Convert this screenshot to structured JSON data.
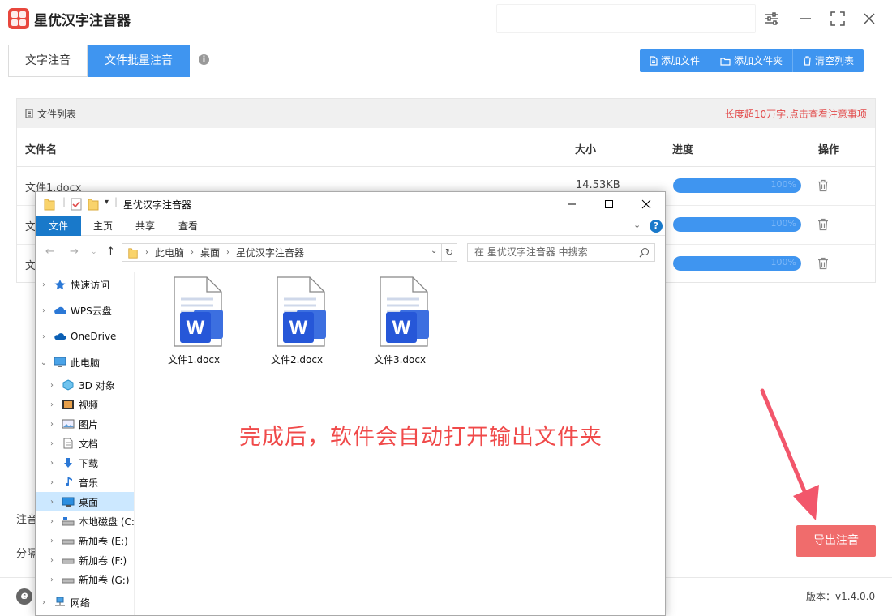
{
  "app": {
    "title": "星优汉字注音器",
    "tabs": [
      {
        "label": "文字注音",
        "active": false
      },
      {
        "label": "文件批量注音",
        "active": true
      }
    ],
    "toolbar": {
      "add_file": "添加文件",
      "add_folder": "添加文件夹",
      "clear_list": "清空列表"
    },
    "panel": {
      "title": "文件列表",
      "warning": "长度超10万字,点击查看注意事项",
      "columns": {
        "name": "文件名",
        "size": "大小",
        "progress": "进度",
        "action": "操作"
      },
      "rows": [
        {
          "name": "文件1.docx",
          "size": "14.53KB",
          "progress": "100%",
          "progress_value": 100
        },
        {
          "name": "文",
          "size": "",
          "progress": "100%",
          "progress_value": 100
        },
        {
          "name": "文",
          "size": "",
          "progress": "100%",
          "progress_value": 100
        }
      ]
    },
    "side_labels": [
      "注音",
      "分隔"
    ],
    "export_button": "导出注音",
    "version": "版本：v1.4.0.0",
    "accent": "#3f95f0",
    "export_color": "#f06c6c"
  },
  "explorer": {
    "title": "星优汉字注音器",
    "ribbon_tabs": [
      "文件",
      "主页",
      "共享",
      "查看"
    ],
    "path": [
      "此电脑",
      "桌面",
      "星优汉字注音器"
    ],
    "search_placeholder": "在 星优汉字注音器 中搜索",
    "nav": [
      {
        "label": "快速访问",
        "icon": "star-icon",
        "level": 0
      },
      {
        "label": "WPS云盘",
        "icon": "cloud-icon",
        "level": 0
      },
      {
        "label": "OneDrive",
        "icon": "onedrive-icon",
        "level": 0
      },
      {
        "label": "此电脑",
        "icon": "computer-icon",
        "level": 0,
        "expanded": true
      },
      {
        "label": "3D 对象",
        "icon": "cube-icon",
        "level": 1
      },
      {
        "label": "视频",
        "icon": "video-icon",
        "level": 1
      },
      {
        "label": "图片",
        "icon": "picture-icon",
        "level": 1
      },
      {
        "label": "文档",
        "icon": "document-icon",
        "level": 1
      },
      {
        "label": "下载",
        "icon": "download-icon",
        "level": 1
      },
      {
        "label": "音乐",
        "icon": "music-icon",
        "level": 1
      },
      {
        "label": "桌面",
        "icon": "desktop-icon",
        "level": 1,
        "selected": true
      },
      {
        "label": "本地磁盘 (C:",
        "icon": "drive-icon",
        "level": 1
      },
      {
        "label": "新加卷 (E:)",
        "icon": "drive-icon",
        "level": 1
      },
      {
        "label": "新加卷 (F:)",
        "icon": "drive-icon",
        "level": 1
      },
      {
        "label": "新加卷 (G:)",
        "icon": "drive-icon",
        "level": 1
      },
      {
        "label": "网络",
        "icon": "network-icon",
        "level": 0
      }
    ],
    "files": [
      "文件1.docx",
      "文件2.docx",
      "文件3.docx"
    ]
  },
  "annotation": "完成后，软件会自动打开输出文件夹"
}
